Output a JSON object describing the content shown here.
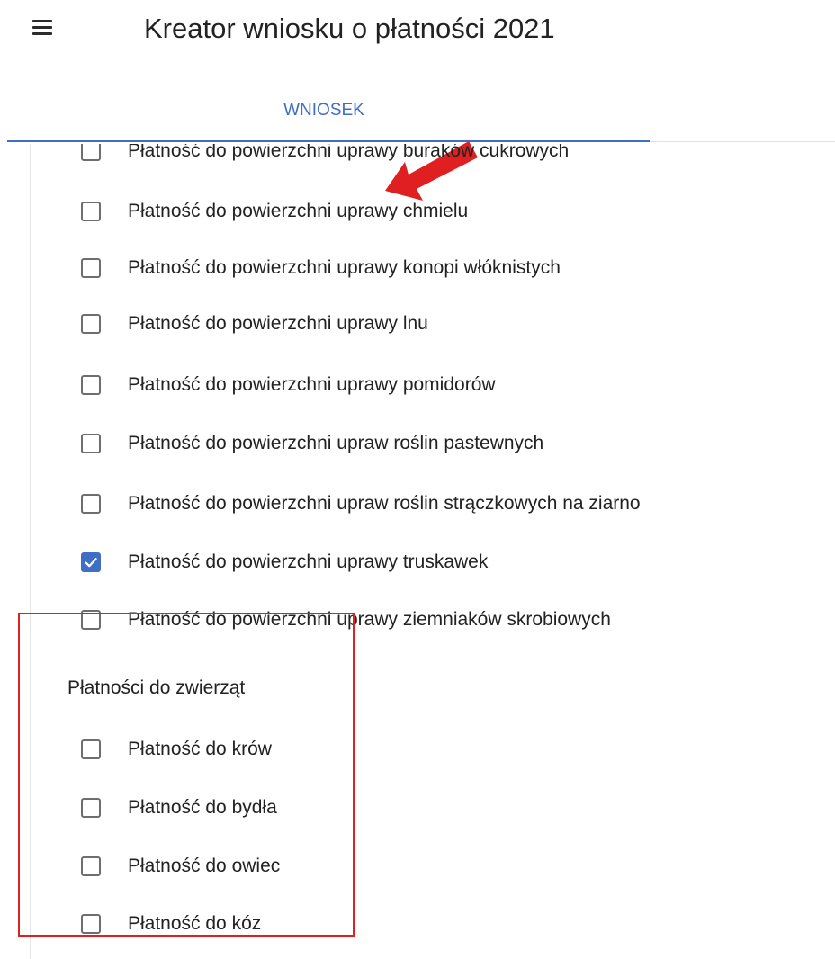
{
  "header": {
    "title": "Kreator wniosku o płatności 2021",
    "menu_icon": "hamburger-menu-icon"
  },
  "tabs": [
    {
      "label": "WNIOSEK",
      "active": true
    }
  ],
  "colors": {
    "accent": "#3f6fc4",
    "annotation_red": "#e02020",
    "text": "#222222",
    "checkbox_border": "#6e6e6e"
  },
  "crop_payments": [
    {
      "label": "Płatność do powierzchni uprawy buraków cukrowych",
      "checked": false
    },
    {
      "label": "Płatność do powierzchni uprawy chmielu",
      "checked": false
    },
    {
      "label": "Płatność do powierzchni uprawy konopi włóknistych",
      "checked": false
    },
    {
      "label": "Płatność do powierzchni uprawy lnu",
      "checked": false
    },
    {
      "label": "Płatność do powierzchni uprawy pomidorów",
      "checked": false
    },
    {
      "label": "Płatność do powierzchni upraw roślin pastewnych",
      "checked": false
    },
    {
      "label": "Płatność do powierzchni upraw roślin strączkowych na ziarno",
      "checked": false
    },
    {
      "label": "Płatność do powierzchni uprawy truskawek",
      "checked": true
    },
    {
      "label": "Płatność do powierzchni uprawy ziemniaków skrobiowych",
      "checked": false
    }
  ],
  "animal_section": {
    "heading": "Płatności do zwierząt",
    "items": [
      {
        "label": "Płatność do krów",
        "checked": false
      },
      {
        "label": "Płatność do bydła",
        "checked": false
      },
      {
        "label": "Płatność do owiec",
        "checked": false
      },
      {
        "label": "Płatność do kóz",
        "checked": false
      }
    ]
  }
}
